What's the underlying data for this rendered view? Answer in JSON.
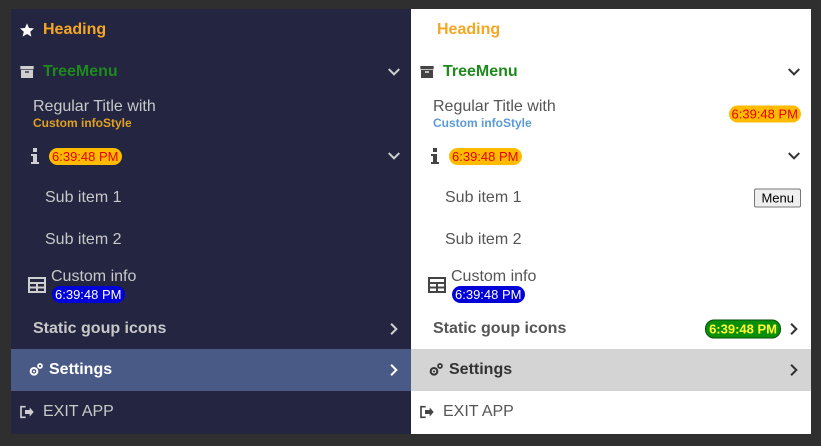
{
  "heading": "Heading",
  "tree_menu": "TreeMenu",
  "regular_title": "Regular Title with",
  "info_style": "Custom infoStyle",
  "time": "6:39:48 PM",
  "sub_item_1": "Sub item 1",
  "sub_item_2": "Sub item 2",
  "custom_info": "Custom info",
  "static_group": "Static goup icons",
  "settings": "Settings",
  "exit": "EXIT APP",
  "menu_button": "Menu",
  "colors": {
    "dark_bg": "#242541",
    "dark_selected": "#4a5a86",
    "light_selected": "#d4d4d4",
    "heading": "#f5a623",
    "tree_menu": "#1e8a1e",
    "dark_info_style": "#e0a020",
    "light_info_style": "#5b9bd5"
  }
}
